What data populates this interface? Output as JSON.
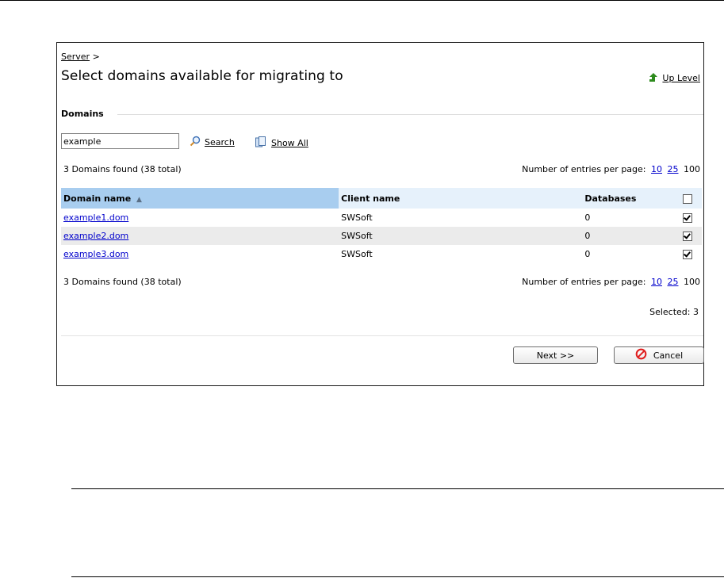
{
  "breadcrumb": {
    "link": "Server",
    "separator": ">"
  },
  "page": {
    "title": "Select domains available for migrating to",
    "up_level": "Up Level"
  },
  "section": {
    "title": "Domains"
  },
  "search": {
    "value": "example",
    "search_label": "Search",
    "show_all_label": "Show All"
  },
  "summary": {
    "found_text": "3 Domains found (38 total)",
    "per_page_label": "Number of entries per page:",
    "per_page_options": [
      "10",
      "25",
      "100"
    ],
    "current_per_page": "100"
  },
  "table": {
    "columns": [
      "Domain name",
      "Client name",
      "Databases"
    ],
    "sort_indicator": "▲",
    "rows": [
      {
        "domain": "example1.dom",
        "client": "SWSoft",
        "databases": "0",
        "checked": true
      },
      {
        "domain": "example2.dom",
        "client": "SWSoft",
        "databases": "0",
        "checked": true
      },
      {
        "domain": "example3.dom",
        "client": "SWSoft",
        "databases": "0",
        "checked": true
      }
    ]
  },
  "selection": {
    "text": "Selected: 3"
  },
  "buttons": {
    "next": "Next >>",
    "cancel": "Cancel"
  },
  "colors": {
    "sorted_header": "#a8cdef",
    "header": "#e6f1fb",
    "link": "#0000cc",
    "up_arrow": "#2e8b1e",
    "cancel_icon": "#e02020"
  },
  "icons": {
    "up_level": "green-up-arrow-icon",
    "search": "magnifier-icon",
    "show_all": "pages-icon",
    "cancel": "no-sign-icon"
  }
}
